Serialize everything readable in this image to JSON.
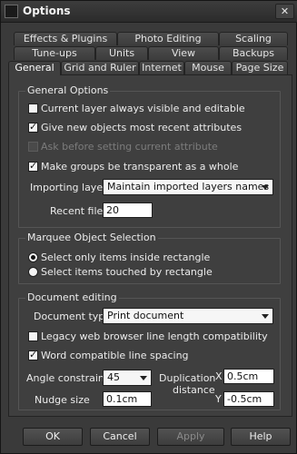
{
  "window": {
    "title": "Options",
    "close_glyph": "✕",
    "app_icon": "app-icon"
  },
  "tabs": {
    "row1": [
      "Effects & Plugins",
      "Photo Editing",
      "Scaling"
    ],
    "row2": [
      "Tune-ups",
      "Units",
      "View",
      "Backups"
    ],
    "row3": [
      "General",
      "Grid and Ruler",
      "Internet",
      "Mouse",
      "Page Size"
    ],
    "active": "General"
  },
  "general_options": {
    "title": "General Options",
    "checkboxes": [
      {
        "label": "Current layer always visible and editable",
        "checked": false,
        "enabled": true
      },
      {
        "label": "Give new objects most recent attributes",
        "checked": true,
        "enabled": true
      },
      {
        "label": "Ask before setting current attribute",
        "checked": false,
        "enabled": false
      },
      {
        "label": "Make groups be transparent as a whole",
        "checked": true,
        "enabled": true
      }
    ],
    "importing_layers_label": "Importing layers",
    "importing_layers_value": "Maintain imported layers names",
    "recent_files_label": "Recent files",
    "recent_files_value": "20"
  },
  "marquee": {
    "title": "Marquee Object Selection",
    "options": [
      {
        "label": "Select only items inside rectangle",
        "selected": true
      },
      {
        "label": "Select items touched by rectangle",
        "selected": false
      }
    ]
  },
  "document_editing": {
    "title": "Document editing",
    "document_type_label": "Document type",
    "document_type_value": "Print document",
    "legacy_label": "Legacy web browser line length compatibility",
    "legacy_checked": false,
    "word_label": "Word compatible line spacing",
    "word_checked": true,
    "angle_label": "Angle constraint",
    "angle_value": "45",
    "nudge_label": "Nudge size",
    "nudge_value": "0.1cm",
    "duplication_label_1": "Duplication",
    "duplication_label_2": "distance",
    "dup_x_label": "X",
    "dup_x_value": "0.5cm",
    "dup_y_label": "Y",
    "dup_y_value": "-0.5cm"
  },
  "buttons": {
    "ok": "OK",
    "cancel": "Cancel",
    "apply": "Apply",
    "help": "Help"
  }
}
